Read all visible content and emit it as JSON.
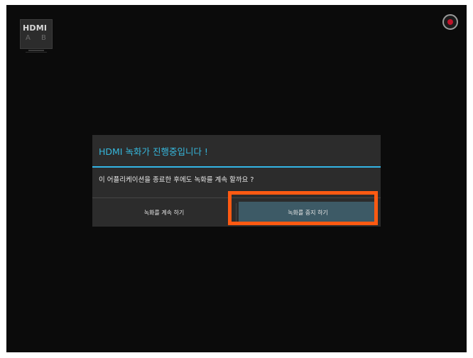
{
  "hdmi_logo": {
    "text": "HDMI",
    "ports": "A B",
    "icon": "hdmi-tv-icon"
  },
  "record_indicator": {
    "icon": "record-icon",
    "dot_color": "#c0132a"
  },
  "dialog": {
    "title": "HDMI 녹화가 진행중입니다 !",
    "message": "이 어플리케이션을 종료한 후에도 녹화를 계속 할까요 ?",
    "buttons": {
      "continue_label": "녹화를 계속 하기",
      "stop_label": "녹화를 중지 하기"
    },
    "accent_color": "#33b5e5"
  },
  "highlight": {
    "color": "#ff5a12",
    "target": "stop-recording-button"
  }
}
